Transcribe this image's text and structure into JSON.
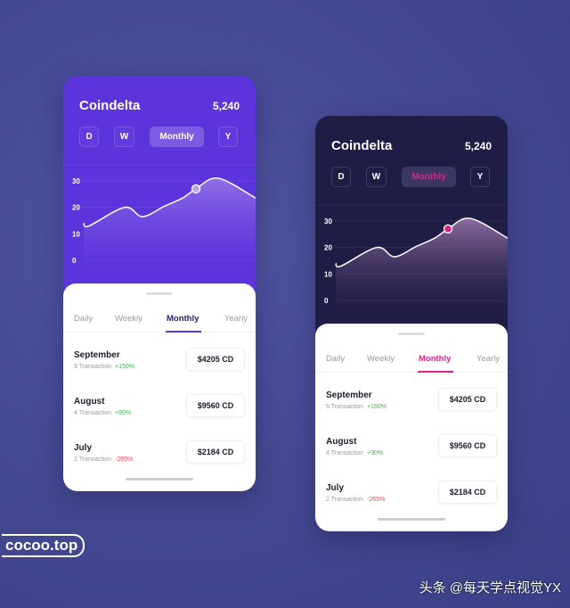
{
  "y_ticks": [
    "30",
    "20",
    "10",
    "0"
  ],
  "trend_values": [
    14.1,
    13,
    20,
    16.5,
    20.5,
    23.5,
    27,
    31,
    23.5
  ],
  "cards": [
    {
      "theme": "light",
      "title": "Coindelta",
      "value": "5,240",
      "periods": [
        "D",
        "W",
        "Monthly",
        "Y"
      ],
      "active_period": 2,
      "tabs": [
        "Daily",
        "Weekly",
        "Monthly",
        "Yearly"
      ],
      "active_tab": 2,
      "accent": "#5b34dc",
      "line_color": "#ffffff",
      "dot_color": "#b9a3f0",
      "rows": [
        {
          "month": "September",
          "tx": "9 Transaction",
          "change": "+150%",
          "amount": "$4205 CD"
        },
        {
          "month": "August",
          "tx": "4 Transaction",
          "change": "+90%",
          "amount": "$9560 CD"
        },
        {
          "month": "July",
          "tx": "2 Transaction",
          "change": "-265%",
          "amount": "$2184 CD"
        }
      ]
    },
    {
      "theme": "dark",
      "title": "Coindelta",
      "value": "5,240",
      "periods": [
        "D",
        "W",
        "Monthly",
        "Y"
      ],
      "active_period": 2,
      "tabs": [
        "Daily",
        "Weekly",
        "Monthly",
        "Yearly"
      ],
      "active_tab": 2,
      "accent": "#e0218a",
      "line_color": "#ffffff",
      "dot_color": "#e0218a",
      "rows": [
        {
          "month": "September",
          "tx": "9 Transaction",
          "change": "+150%",
          "amount": "$4205 CD"
        },
        {
          "month": "August",
          "tx": "4 Transaction",
          "change": "+90%",
          "amount": "$9560 CD"
        },
        {
          "month": "July",
          "tx": "2 Transaction",
          "change": "-265%",
          "amount": "$2184 CD"
        }
      ]
    }
  ],
  "branding": {
    "logo": "cocoo.top",
    "watermark": "头条 @每天学点视觉YX"
  }
}
